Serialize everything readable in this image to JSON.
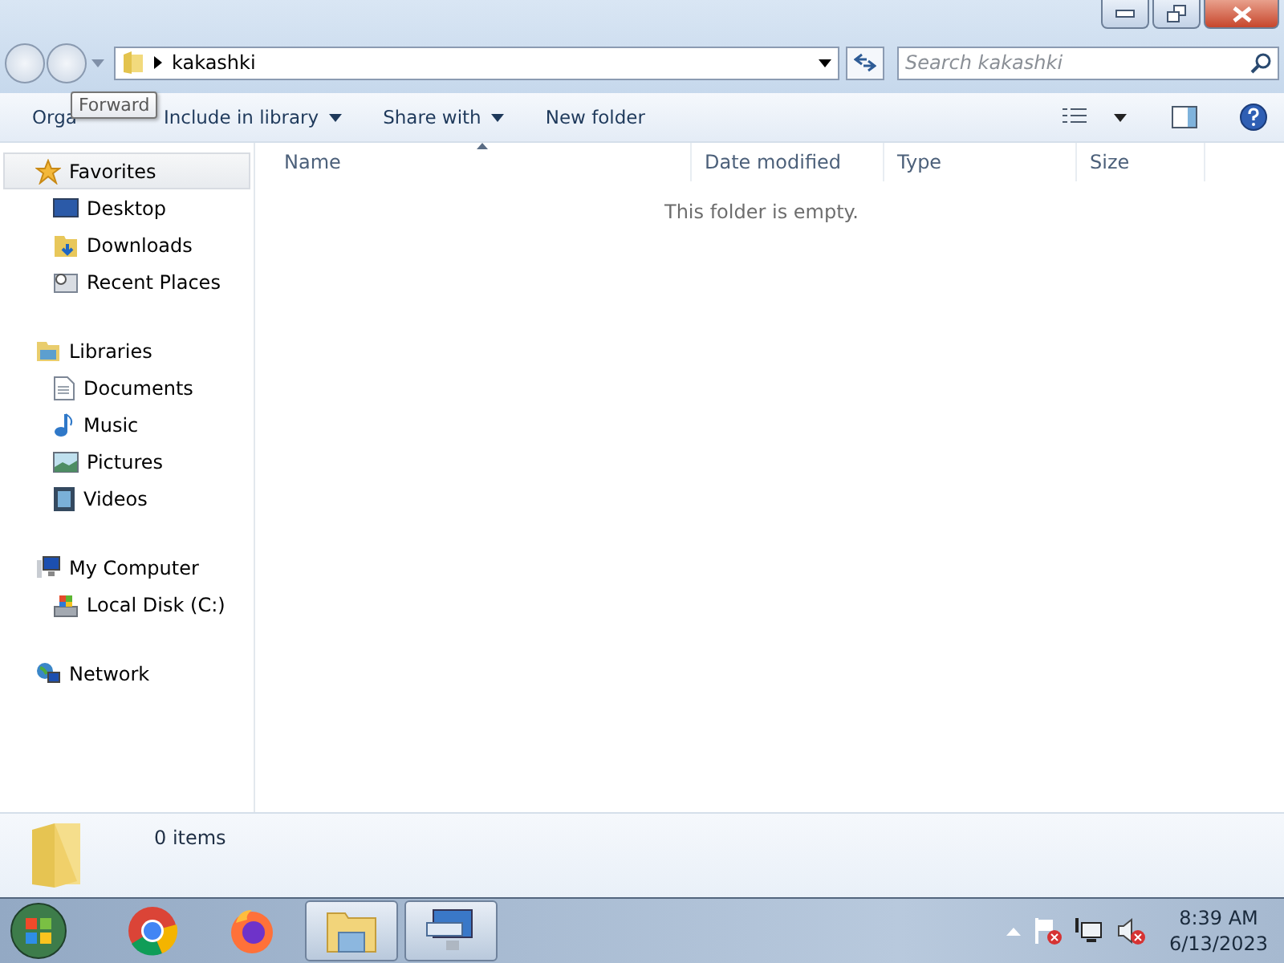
{
  "address": {
    "path": "kakashki"
  },
  "search": {
    "placeholder": "Search kakashki"
  },
  "tooltip": {
    "text": "Forward"
  },
  "toolbar": {
    "buttons": [
      {
        "label": "Orga",
        "dropdown": false
      },
      {
        "label": "Include in library",
        "dropdown": true
      },
      {
        "label": "Share with",
        "dropdown": true
      },
      {
        "label": "New folder",
        "dropdown": false
      }
    ]
  },
  "sidebar": {
    "groups": [
      {
        "label": "Favorites",
        "selected": true,
        "children": [
          {
            "label": "Desktop",
            "selected": false
          },
          {
            "label": "Downloads",
            "selected": false
          },
          {
            "label": "Recent Places",
            "selected": false
          }
        ]
      },
      {
        "label": "Libraries",
        "selected": false,
        "children": [
          {
            "label": "Documents",
            "selected": false
          },
          {
            "label": "Music",
            "selected": false
          },
          {
            "label": "Pictures",
            "selected": false
          },
          {
            "label": "Videos",
            "selected": false
          }
        ]
      },
      {
        "label": "My Computer",
        "selected": false,
        "children": [
          {
            "label": "Local Disk (C:)",
            "selected": false
          }
        ]
      },
      {
        "label": "Network",
        "selected": false
      }
    ]
  },
  "table": {
    "columns": [
      "Name",
      "Date modified",
      "Type",
      "Size"
    ],
    "empty_message": "This folder is empty."
  },
  "details": {
    "count": "0 items"
  },
  "taskbar": {
    "apps": [
      {
        "open": false
      },
      {
        "open": false
      },
      {
        "open": true
      },
      {
        "open": true
      }
    ],
    "clock": {
      "time": "8:39 AM",
      "date": "6/13/2023"
    }
  }
}
